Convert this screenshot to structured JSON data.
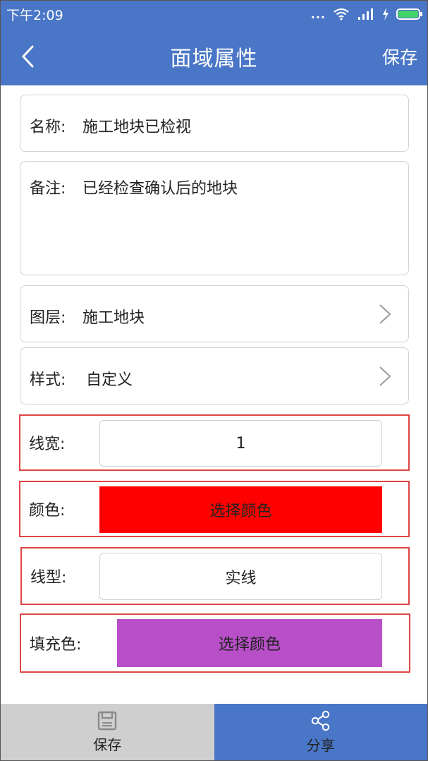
{
  "status_bar": {
    "time": "下午2:09",
    "dots": "...",
    "icons": [
      "wifi-icon",
      "signal-icon",
      "charging-icon",
      "battery-icon"
    ]
  },
  "header": {
    "title": "面域属性",
    "save_label": "保存",
    "back_icon": "chevron-left-icon"
  },
  "form": {
    "name": {
      "label": "名称:",
      "value": "施工地块已检视"
    },
    "remark": {
      "label": "备注:",
      "value": "已经检查确认后的地块"
    },
    "layer": {
      "label": "图层:",
      "value": "施工地块"
    },
    "style": {
      "label": "样式:",
      "value": "自定义"
    },
    "line_width": {
      "label": "线宽:",
      "value": "1"
    },
    "color": {
      "label": "颜色:",
      "button_label": "选择颜色",
      "color": "#ff0000"
    },
    "line_type": {
      "label": "线型:",
      "value": "实线"
    },
    "fill_color": {
      "label": "填充色:",
      "button_label": "选择颜色",
      "color": "#b84fc8"
    }
  },
  "bottom_bar": {
    "save_label": "保存",
    "share_label": "分享"
  },
  "colors": {
    "primary": "#4a76c7",
    "highlight_border": "#e04545"
  }
}
